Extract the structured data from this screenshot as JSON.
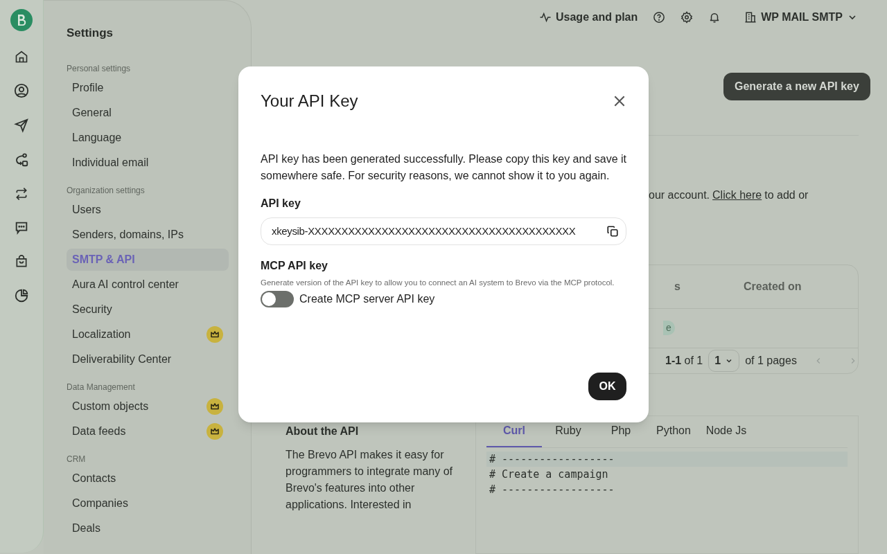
{
  "settings_nav": {
    "title": "Settings",
    "sections": [
      {
        "heading": "Personal settings",
        "items": [
          {
            "label": "Profile",
            "selected": false,
            "premium": false
          },
          {
            "label": "General",
            "selected": false,
            "premium": false
          },
          {
            "label": "Language",
            "selected": false,
            "premium": false
          },
          {
            "label": "Individual email",
            "selected": false,
            "premium": false
          }
        ]
      },
      {
        "heading": "Organization settings",
        "items": [
          {
            "label": "Users",
            "selected": false,
            "premium": false
          },
          {
            "label": "Senders, domains, IPs",
            "selected": false,
            "premium": false
          },
          {
            "label": "SMTP & API",
            "selected": true,
            "premium": false
          },
          {
            "label": "Aura AI control center",
            "selected": false,
            "premium": false
          },
          {
            "label": "Security",
            "selected": false,
            "premium": false
          },
          {
            "label": "Localization",
            "selected": false,
            "premium": true
          },
          {
            "label": "Deliverability Center",
            "selected": false,
            "premium": false
          }
        ]
      },
      {
        "heading": "Data Management",
        "items": [
          {
            "label": "Custom objects",
            "selected": false,
            "premium": true
          },
          {
            "label": "Data feeds",
            "selected": false,
            "premium": true
          }
        ]
      },
      {
        "heading": "CRM",
        "items": [
          {
            "label": "Contacts",
            "selected": false,
            "premium": false
          },
          {
            "label": "Companies",
            "selected": false,
            "premium": false
          },
          {
            "label": "Deals",
            "selected": false,
            "premium": false
          }
        ]
      }
    ]
  },
  "top_bar": {
    "usage": "Usage and plan",
    "account": "WP MAIL SMTP"
  },
  "generate_button": "Generate a new API key",
  "info_text": {
    "before": "our account.",
    "link": "Click here",
    "after": "to add or"
  },
  "keys_table": {
    "columns": [
      "s",
      "Created on"
    ],
    "row_badge": "e",
    "pagination": {
      "range": "**1-1** of 1",
      "page": "1",
      "of_pages": "of 1 pages"
    }
  },
  "about": {
    "title": "About the API",
    "body": "The Brevo API makes it easy for programmers to integrate many of Brevo's features into other applications. Interested in"
  },
  "code_tabs": [
    {
      "label": "Curl",
      "selected": true
    },
    {
      "label": "Ruby",
      "selected": false
    },
    {
      "label": "Php",
      "selected": false
    },
    {
      "label": "Python",
      "selected": false
    },
    {
      "label": "Node Js",
      "selected": false
    }
  ],
  "code_lines": [
    "# ------------------",
    "# Create a campaign",
    "# ------------------"
  ],
  "modal": {
    "title": "Your API Key",
    "message": "API key has been generated successfully. Please copy this key and save it somewhere safe. For security reasons, we cannot show it to you again.",
    "key_label": "API key",
    "key_value": "xkeysib-XXXXXXXXXXXXXXXXXXXXXXXXXXXXXXXXXXXXXXXX",
    "mcp_label": "MCP API key",
    "mcp_help": "Generate version of the API key to allow you to connect an AI system to Brevo via the MCP protocol.",
    "mcp_toggle": {
      "label": "Create MCP server API key",
      "on": false
    },
    "ok": "OK"
  }
}
